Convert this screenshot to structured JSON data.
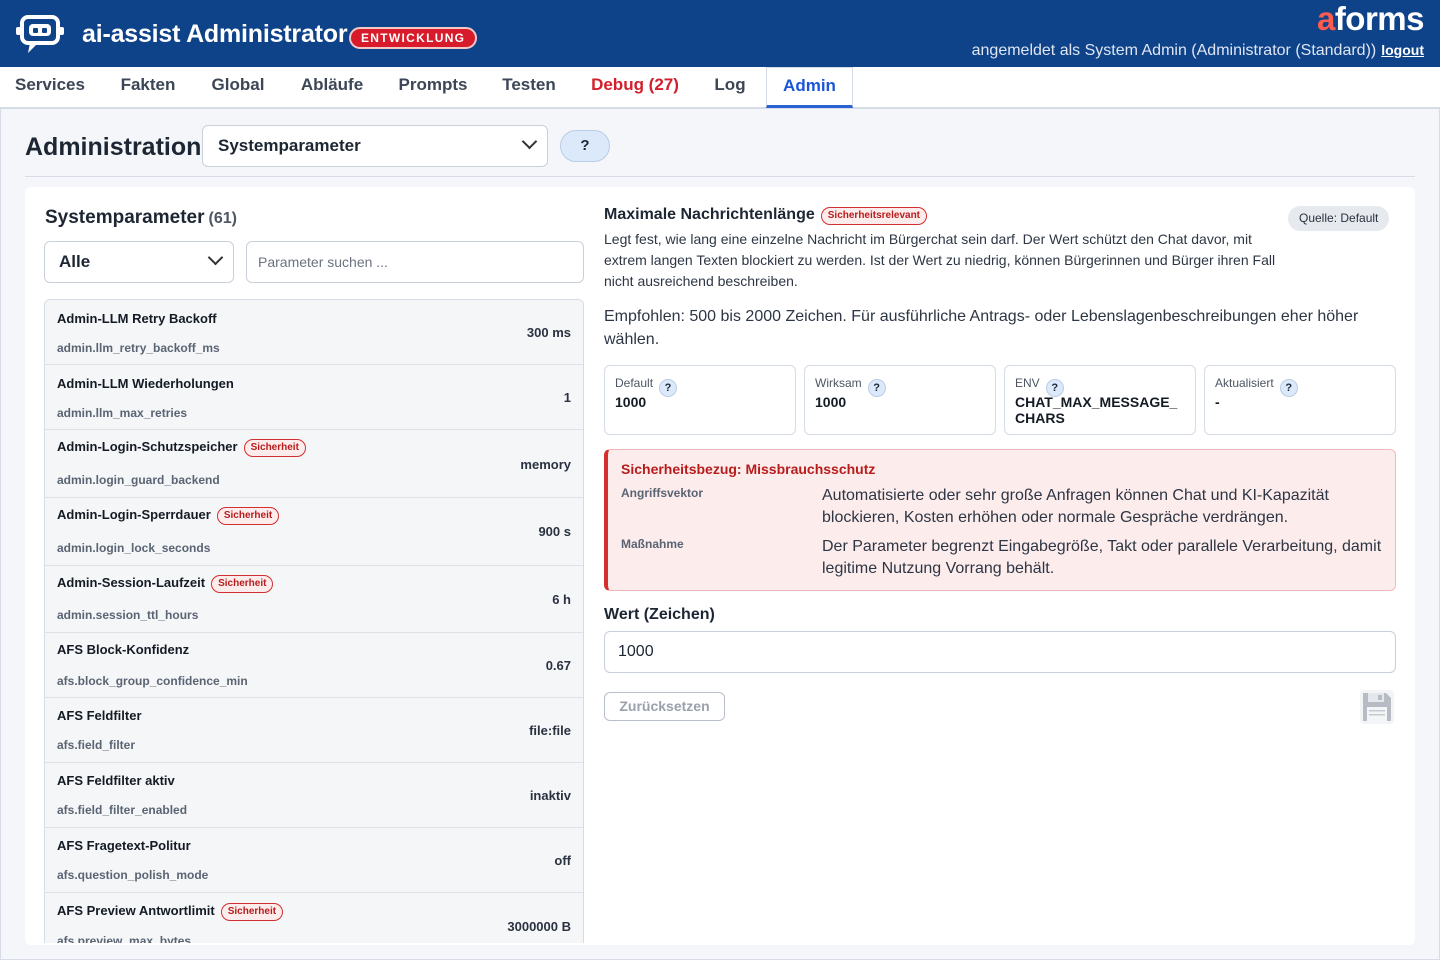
{
  "header": {
    "app_title": "ai-assist Administrator",
    "env_badge": "ENTWICKLUNG",
    "brand_a": "a",
    "brand_rest": "forms",
    "user_text": "angemeldet als System Admin (Administrator (Standard))",
    "logout_label": "logout"
  },
  "nav": {
    "tabs": [
      {
        "label": "Services"
      },
      {
        "label": "Fakten"
      },
      {
        "label": "Global"
      },
      {
        "label": "Abläufe"
      },
      {
        "label": "Prompts"
      },
      {
        "label": "Testen"
      },
      {
        "label": "Debug (27)"
      },
      {
        "label": "Log"
      },
      {
        "label": "Admin"
      }
    ]
  },
  "page": {
    "title": "Administration",
    "section_select": "Systemparameter",
    "help_label": "?"
  },
  "list": {
    "title": "Systemparameter",
    "count": "(61)",
    "filter_value": "Alle",
    "search_placeholder": "Parameter suchen ...",
    "badge_label": "Sicherheit",
    "items": [
      {
        "name": "Admin-LLM Retry Backoff",
        "key": "admin.llm_retry_backoff_ms",
        "value": "300 ms"
      },
      {
        "name": "Admin-LLM Wiederholungen",
        "key": "admin.llm_max_retries",
        "value": "1"
      },
      {
        "name": "Admin-Login-Schutzspeicher",
        "key": "admin.login_guard_backend",
        "value": "memory"
      },
      {
        "name": "Admin-Login-Sperrdauer",
        "key": "admin.login_lock_seconds",
        "value": "900 s"
      },
      {
        "name": "Admin-Session-Laufzeit",
        "key": "admin.session_ttl_hours",
        "value": "6 h"
      },
      {
        "name": "AFS Block-Konfidenz",
        "key": "afs.block_group_confidence_min",
        "value": "0.67"
      },
      {
        "name": "AFS Feldfilter",
        "key": "afs.field_filter",
        "value": "file:file"
      },
      {
        "name": "AFS Feldfilter aktiv",
        "key": "afs.field_filter_enabled",
        "value": "inaktiv"
      },
      {
        "name": "AFS Fragetext-Politur",
        "key": "afs.question_polish_mode",
        "value": "off"
      },
      {
        "name": "AFS Preview Antwortlimit",
        "key": "afs.preview_max_bytes",
        "value": "3000000 B"
      }
    ]
  },
  "detail": {
    "title": "Maximale Nachrichtenlänge",
    "badge": "Sicherheitsrelevant",
    "source": "Quelle: Default",
    "description": "Legt fest, wie lang eine einzelne Nachricht im Bürgerchat sein darf. Der Wert schützt den Chat davor, mit extrem langen Texten blockiert zu werden. Ist der Wert zu niedrig, können Bürgerinnen und Bürger ihren Fall nicht ausreichend beschreiben.",
    "recommendation": "Empfohlen: 500 bis 2000 Zeichen. Für ausführliche Antrags- oder Lebenslagenbeschreibungen eher höher wählen.",
    "info_boxes": [
      {
        "label": "Default",
        "value": "1000"
      },
      {
        "label": "Wirksam",
        "value": "1000"
      },
      {
        "label": "ENV",
        "value": "CHAT_MAX_MESSAGE_CHARS"
      },
      {
        "label": "Aktualisiert",
        "value": "-"
      }
    ],
    "help_q": "?",
    "security": {
      "title": "Sicherheitsbezug: Missbrauchsschutz",
      "vector_label": "Angriffsvektor",
      "vector_text": "Automatisierte oder sehr große Anfragen können Chat und KI-Kapazität blockieren, Kosten erhöhen oder normale Gespräche verdrängen.",
      "measure_label": "Maßnahme",
      "measure_text": "Der Parameter begrenzt Eingabegröße, Takt oder parallele Verarbeitung, damit legitime Nutzung Vorrang behält."
    },
    "value_label": "Wert (Zeichen)",
    "value": "1000",
    "reset_label": "Zurücksetzen"
  },
  "colors": {
    "header_bg": "#0e4289",
    "accent": "#1a56d6",
    "danger": "#d32f2f",
    "brand_a": "#ff5a4e"
  },
  "icons": {
    "logo": "robot-chat-icon",
    "select_chevron": "chevron-down-icon",
    "save": "floppy-disk-icon"
  }
}
